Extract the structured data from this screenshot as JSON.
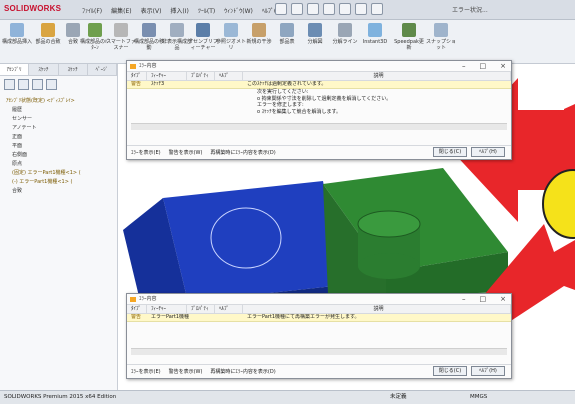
{
  "app": {
    "logo": "SOLIDWORKS",
    "menus": [
      "ﾌｧｲﾙ(F)",
      "編集(E)",
      "表示(V)",
      "挿入(I)",
      "ﾂｰﾙ(T)",
      "ｳｨﾝﾄﾞｳ(W)",
      "ﾍﾙﾌﾟ(H)"
    ],
    "search_label": "エラー状況..."
  },
  "ribbon": {
    "buttons": [
      "構成部品挿入",
      "部品の合致",
      "合致",
      "構成部品のﾊﾟﾀｰﾝ",
      "スマートファスナー",
      "構成部品の移動",
      "非表示構成部品",
      "アセンブリフィーチャー",
      "参照ジオメトリ",
      "新規の干渉",
      "部品表",
      "分解図",
      "分解ライン",
      "Instant3D",
      "Speedpak更新",
      "スナップショット"
    ]
  },
  "tree": {
    "tabs": [
      "ｱｾﾝﾌﾞﾘ",
      "ｽｹｯﾁ",
      "ｽｹｯﾁ",
      "ﾍﾟｰｼﾞ"
    ],
    "items": [
      "ｱｾﾝﾌﾞﾘ状態(既定) <ﾃﾞｨｽﾌﾟﾚｲ>",
      "履歴",
      "センサー",
      "アノテート",
      "正面",
      "平面",
      "右側面",
      "原点",
      "(固定) エラーPart1機種<1> (",
      "(-) エラーPart1機種<1> (",
      "合致"
    ]
  },
  "dialog1": {
    "title": "ｴﾗｰ内容",
    "columns": [
      "ﾀｲﾌﾟ",
      "ﾌｨｰﾁｬｰ",
      "ﾌﾟﾛﾊﾟﾃｨ",
      "ﾍﾙﾌﾟ",
      "説明"
    ],
    "rows": [
      {
        "type": "警告",
        "feature": "ｽｹｯﾁ3",
        "desc": "このｽｹｯﾁは過剰定義されています。"
      }
    ],
    "desc_lines": [
      "次を実行してください:",
      "o 拘束関係や寸法を削除して過剰定義を解消してください。",
      "エラーを修正します:",
      "o ｽｹｯﾁを編集して競合を解消します。"
    ],
    "footer_checks": [
      "ｴﾗｰを表示(E)",
      "警告を表示(W)",
      "再構築時にｴﾗｰ内容を表示(D)"
    ],
    "btn_close": "閉じる(C)",
    "btn_help": "ﾍﾙﾌﾟ(H)"
  },
  "dialog2": {
    "title": "ｴﾗｰ内容",
    "columns": [
      "ﾀｲﾌﾟ",
      "ﾌｨｰﾁｬｰ",
      "ﾌﾟﾛﾊﾟﾃｨ",
      "ﾍﾙﾌﾟ",
      "説明"
    ],
    "rows": [
      {
        "type": "警告",
        "feature": "エラーPart1機種",
        "desc": "エラーPart1機種にて再構築エラーが発生します。"
      }
    ],
    "footer_checks": [
      "ｴﾗｰを表示(E)",
      "警告を表示(W)",
      "再構築時にｴﾗｰ内容を表示(D)"
    ],
    "btn_close": "閉じる(C)",
    "btn_help": "ﾍﾙﾌﾟ(H)"
  },
  "status": {
    "left": "SOLIDWORKS Premium 2015 x64 Edition",
    "mid": "未定義",
    "right": "MMGS"
  },
  "colors": {
    "arrow": "#e8262a",
    "blue_block": "#1f3fbf",
    "green_block": "#2f8a33",
    "callout_yellow": "#f5e21a"
  }
}
